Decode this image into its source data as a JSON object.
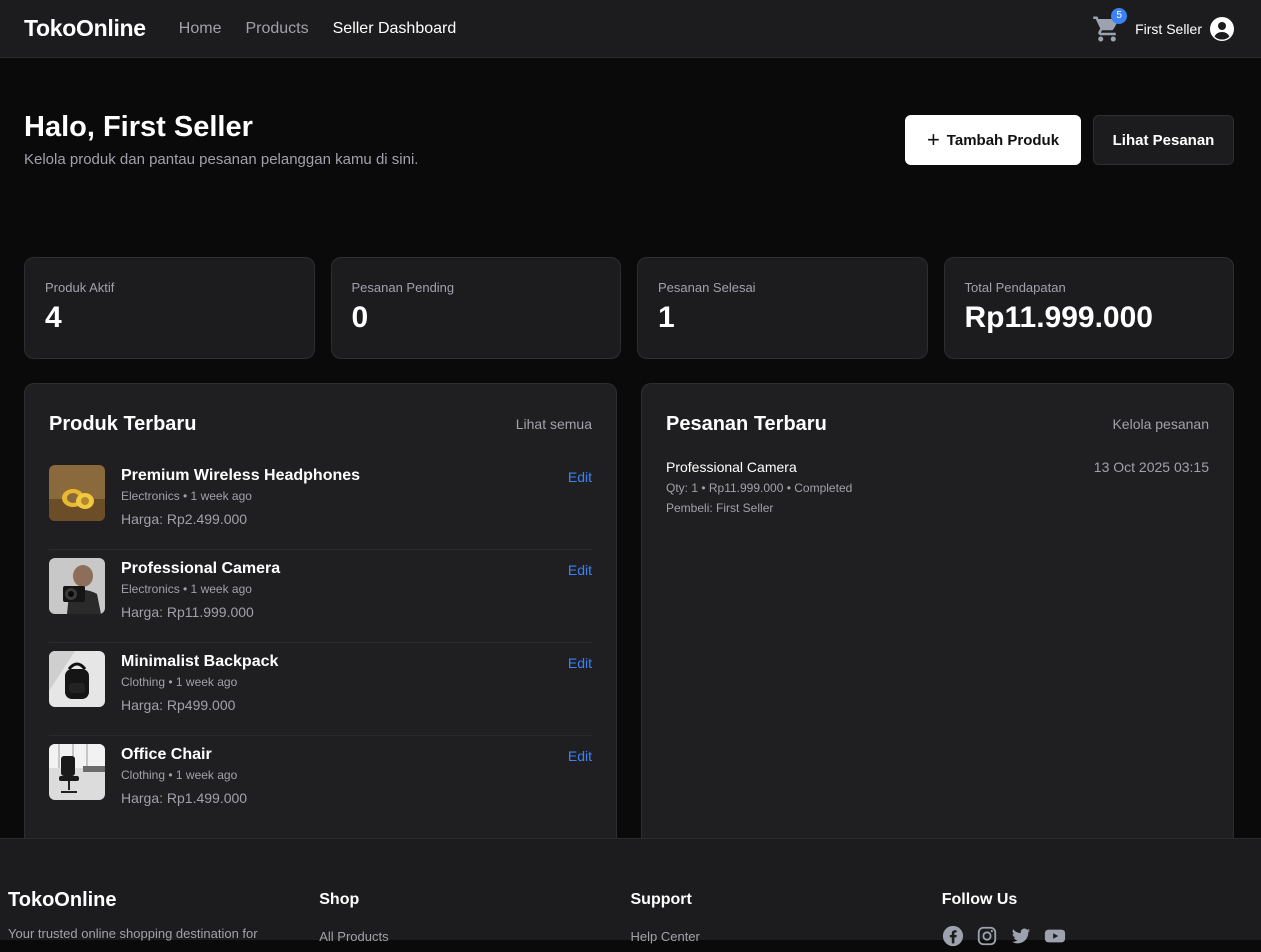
{
  "nav": {
    "brand": "TokoOnline",
    "links": [
      "Home",
      "Products",
      "Seller Dashboard"
    ],
    "cart_count": "5",
    "user_name": "First Seller"
  },
  "hero": {
    "title": "Halo, First Seller",
    "subtitle": "Kelola produk dan pantau pesanan pelanggan kamu di sini.",
    "add_product": "Tambah Produk",
    "view_orders": "Lihat Pesanan"
  },
  "stats": [
    {
      "label": "Produk Aktif",
      "value": "4"
    },
    {
      "label": "Pesanan Pending",
      "value": "0"
    },
    {
      "label": "Pesanan Selesai",
      "value": "1"
    },
    {
      "label": "Total Pendapatan",
      "value": "Rp11.999.000"
    }
  ],
  "products_panel": {
    "title": "Produk Terbaru",
    "link": "Lihat semua",
    "edit_label": "Edit",
    "items": [
      {
        "name": "Premium Wireless Headphones",
        "meta": "Electronics • 1 week ago",
        "price": "Harga: Rp2.499.000"
      },
      {
        "name": "Professional Camera",
        "meta": "Electronics • 1 week ago",
        "price": "Harga: Rp11.999.000"
      },
      {
        "name": "Minimalist Backpack",
        "meta": "Clothing • 1 week ago",
        "price": "Harga: Rp499.000"
      },
      {
        "name": "Office Chair",
        "meta": "Clothing • 1 week ago",
        "price": "Harga: Rp1.499.000"
      }
    ]
  },
  "orders_panel": {
    "title": "Pesanan Terbaru",
    "link": "Kelola pesanan",
    "items": [
      {
        "name": "Professional Camera",
        "meta": "Qty: 1 • Rp11.999.000 • Completed",
        "buyer": "Pembeli: First Seller",
        "date": "13 Oct 2025 03:15"
      }
    ]
  },
  "footer": {
    "brand": "TokoOnline",
    "desc": "Your trusted online shopping destination for",
    "shop_title": "Shop",
    "shop_link": "All Products",
    "support_title": "Support",
    "support_link": "Help Center",
    "follow_title": "Follow Us",
    "social_icons": [
      "facebook-icon",
      "instagram-icon",
      "twitter-icon",
      "youtube-icon"
    ]
  },
  "colors": {
    "accent": "#3b82f6",
    "background": "#0a0a0a",
    "card": "#1c1c1e"
  }
}
